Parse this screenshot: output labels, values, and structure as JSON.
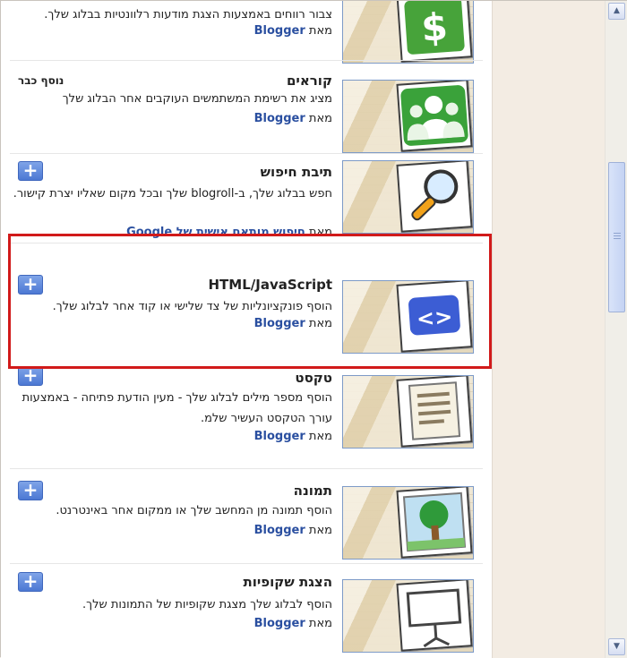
{
  "gadgets": [
    {
      "id": "adsense",
      "title": "",
      "desc": "צבור רווחים באמצעות הצגת מודעות רלוונטיות בבלוג שלך.",
      "by_prefix": "מאת",
      "by": "Blogger",
      "status": "add",
      "icon": "dollar-icon"
    },
    {
      "id": "followers",
      "title": "קוראים",
      "desc": "מציג את רשימת המשתמשים העוקבים אחר הבלוג שלך",
      "by_prefix": "מאת",
      "by": "Blogger",
      "status": "added",
      "added_label": "נוסף כבר",
      "icon": "people-icon"
    },
    {
      "id": "search",
      "title": "תיבת חיפוש",
      "desc": "חפש בבלוג שלך, ב-blogroll שלך ובכל מקום שאליו יצרת קישור.",
      "by_prefix": "מאת",
      "by": "חיפוש מותאם אישית של Google",
      "status": "add",
      "icon": "magnifier-icon"
    },
    {
      "id": "html",
      "title": "HTML/JavaScript",
      "desc": "הוסף פונקציונליות של צד שלישי או קוד אחר לבלוג שלך.",
      "by_prefix": "מאת",
      "by": "Blogger",
      "status": "add",
      "icon": "code-brackets-icon"
    },
    {
      "id": "text",
      "title": "טקסט",
      "desc": "הוסף מספר מילים לבלוג שלך - מעין הודעת פתיחה - באמצעות עורך הטקסט העשיר שלמ.",
      "by_prefix": "מאת",
      "by": "Blogger",
      "status": "add",
      "icon": "text-document-icon"
    },
    {
      "id": "image",
      "title": "תמונה",
      "desc": "הוסף תמונה מן המחשב שלך או ממקום אחר באינטרנט.",
      "by_prefix": "מאת",
      "by": "Blogger",
      "status": "add",
      "icon": "tree-picture-icon"
    },
    {
      "id": "slideshow",
      "title": "הצגת שקופיות",
      "desc": "הוסף לבלוג שלך מצגת שקופיות של התמונות שלך.",
      "by_prefix": "מאת",
      "by": "Blogger",
      "status": "add",
      "icon": "projector-screen-icon"
    }
  ],
  "add_symbol": "+",
  "scroll": {
    "up_arrow": "▲",
    "down_arrow": "▼"
  },
  "colors": {
    "highlight": "#d11a1a",
    "link": "#2a4fa0",
    "add_button": "#4c78d3",
    "side_panel": "#f3ece3"
  }
}
